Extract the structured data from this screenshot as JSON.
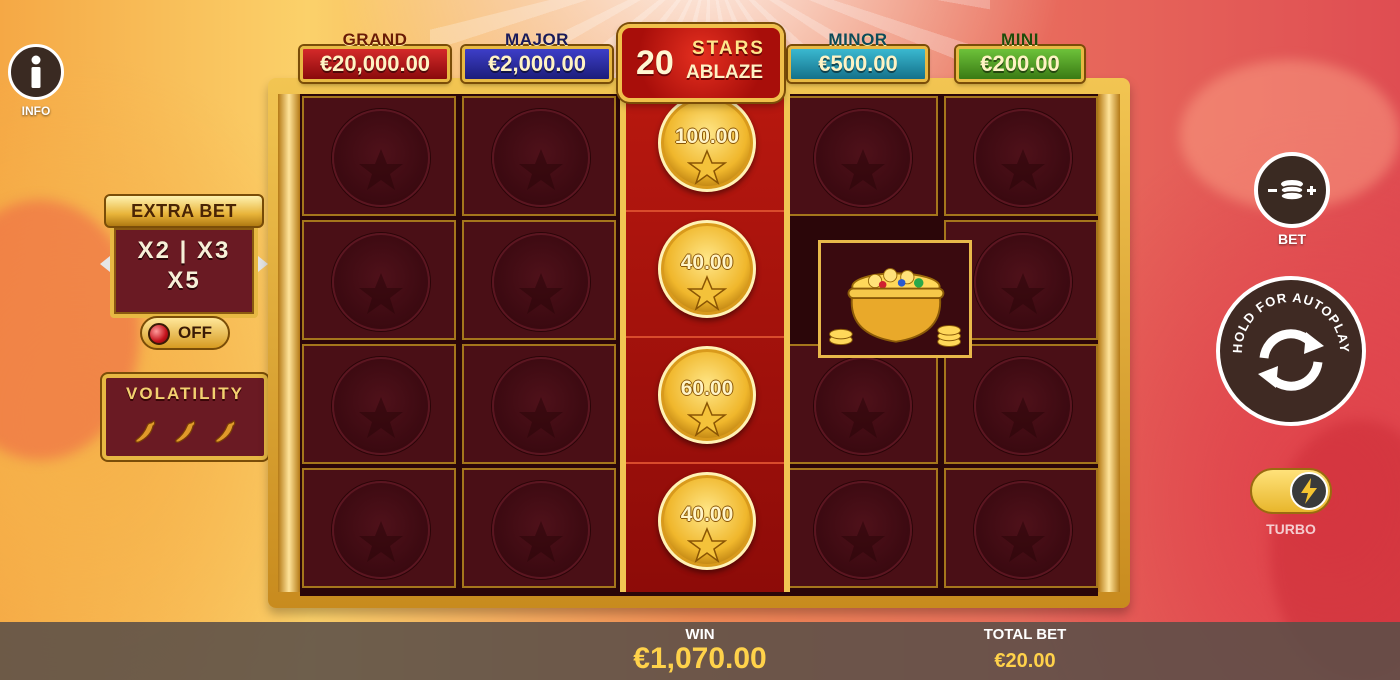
{
  "info": {
    "label": "INFO"
  },
  "jackpots": [
    {
      "title": "GRAND",
      "value": "€20,000.00",
      "color": "#b8131a"
    },
    {
      "title": "MAJOR",
      "value": "€2,000.00",
      "color": "#2b2ea8"
    },
    {
      "title": "MINOR",
      "value": "€500.00",
      "color": "#1d8aa6"
    },
    {
      "title": "MINI",
      "value": "€200.00",
      "color": "#4a9a20"
    }
  ],
  "logo": {
    "number": "20",
    "word1": "STARS",
    "word2": "ABLAZE"
  },
  "extra_bet": {
    "title": "EXTRA BET",
    "line1": "X2 | X3",
    "line2": "X5",
    "state": "OFF"
  },
  "volatility": {
    "title": "VOLATILITY",
    "level": 3
  },
  "reels": {
    "hot_coin_values": [
      "100.00",
      "40.00",
      "60.00",
      "40.00"
    ],
    "special_symbol": "pot-of-gold"
  },
  "controls": {
    "bet_label": "BET",
    "autoplay_text": "HOLD FOR AUTOPLAY",
    "turbo_label": "TURBO"
  },
  "bottom": {
    "win_label": "WIN",
    "win_value": "€1,070.00",
    "total_bet_label": "TOTAL BET",
    "total_bet_value": "€20.00"
  }
}
